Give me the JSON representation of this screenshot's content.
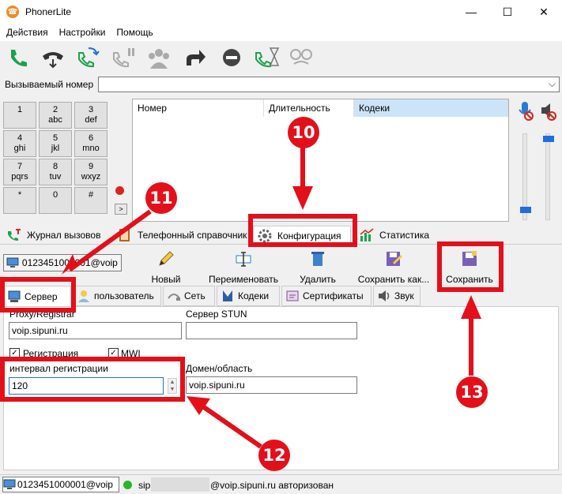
{
  "window": {
    "title": "PhonerLite",
    "minimize": "—",
    "maximize": "☐",
    "close": "✕"
  },
  "menu": [
    "Действия",
    "Настройки",
    "Помощь"
  ],
  "number_row": {
    "label": "Вызываемый номер",
    "value": ""
  },
  "dialpad": [
    {
      "d": "1",
      "l": ""
    },
    {
      "d": "2",
      "l": "abc"
    },
    {
      "d": "3",
      "l": "def"
    },
    {
      "d": "4",
      "l": "ghi"
    },
    {
      "d": "5",
      "l": "jkl"
    },
    {
      "d": "6",
      "l": "mno"
    },
    {
      "d": "7",
      "l": "pqrs"
    },
    {
      "d": "8",
      "l": "tuv"
    },
    {
      "d": "9",
      "l": "wxyz"
    },
    {
      "d": "*",
      "l": ""
    },
    {
      "d": "0",
      "l": ""
    },
    {
      "d": "#",
      "l": ""
    }
  ],
  "dial_small_btn": ">",
  "call_list": {
    "headers": [
      "Номер",
      "Длительность",
      "Кодеки"
    ]
  },
  "volume": {
    "mic_level": 0.1,
    "speaker_level": 0.98
  },
  "main_tabs": [
    "Журнал вызовов",
    "Телефонный справочник",
    "Конфигурация",
    "Статистика"
  ],
  "account": {
    "selected": "0123451000001@voip"
  },
  "actions": [
    "Новый",
    "Переименовать",
    "Удалить",
    "Сохранить как...",
    "Сохранить"
  ],
  "config_tabs": [
    "Сервер",
    "пользователь",
    "Сеть",
    "Кодеки",
    "Сертификаты",
    "Звук"
  ],
  "server": {
    "proxy_label": "Proxy/Registrar",
    "proxy_value": "voip.sipuni.ru",
    "stun_label": "Сервер STUN",
    "stun_value": "",
    "registration_label": "Регистрация",
    "registration_checked": true,
    "mwi_label": "MWI",
    "mwi_checked": true,
    "interval_label": "интервал регистрации",
    "interval_value": "120",
    "domain_label": "Домен/область",
    "domain_value": "voip.sipuni.ru"
  },
  "status": {
    "account": "0123451000001@voip",
    "text_prefix": "sip",
    "text_suffix": "@voip.sipuni.ru авторизован"
  },
  "annotations": [
    "10",
    "11",
    "12",
    "13"
  ],
  "colors": {
    "accent_red": "#e3101a",
    "green_call": "#1aa34a",
    "status_ok": "#2bb52b"
  }
}
